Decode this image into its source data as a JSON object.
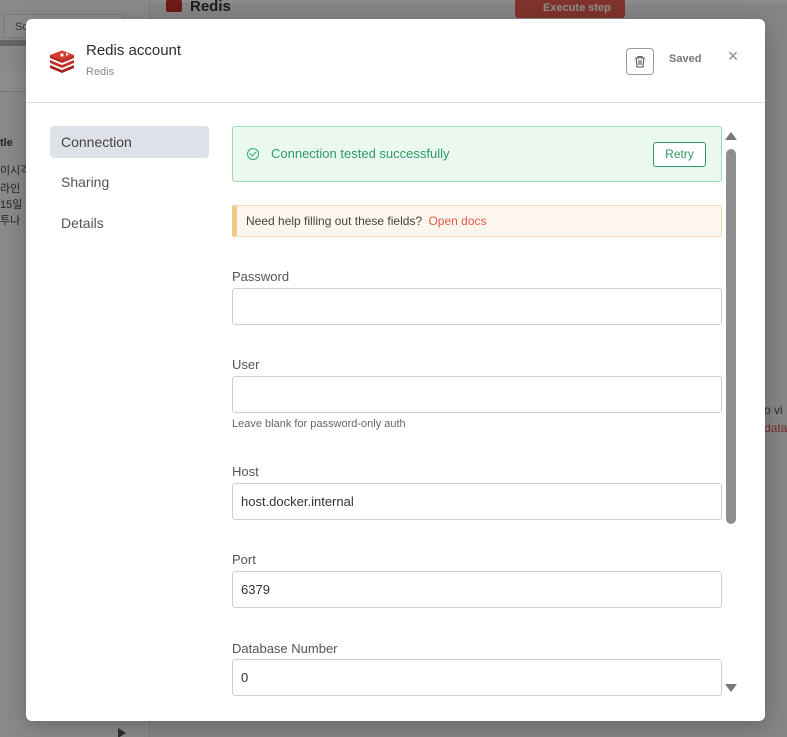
{
  "background": {
    "node_title": "Redis",
    "execute_label": "Execute step",
    "tab_label": "Sc",
    "left_texts": [
      "tle",
      "이시각",
      "라인",
      "15일",
      "투나"
    ],
    "right_texts": [
      "o vi",
      "data"
    ]
  },
  "modal": {
    "title": "Redis account",
    "subtitle": "Redis",
    "saved_label": "Saved",
    "close_symbol": "×"
  },
  "sidebar": {
    "items": [
      {
        "label": "Connection",
        "active": true
      },
      {
        "label": "Sharing",
        "active": false
      },
      {
        "label": "Details",
        "active": false
      }
    ]
  },
  "status": {
    "message": "Connection tested successfully",
    "retry_label": "Retry"
  },
  "help": {
    "text": "Need help filling out these fields?",
    "link": "Open docs"
  },
  "fields": {
    "password": {
      "label": "Password",
      "value": ""
    },
    "user": {
      "label": "User",
      "value": "",
      "hint": "Leave blank for password-only auth"
    },
    "host": {
      "label": "Host",
      "value": "host.docker.internal"
    },
    "port": {
      "label": "Port",
      "value": "6379"
    },
    "database": {
      "label": "Database Number",
      "value": "0"
    }
  },
  "colors": {
    "redis_red": "#c8312a",
    "success_green": "#2d9b63",
    "link_red": "#e55a4a"
  }
}
